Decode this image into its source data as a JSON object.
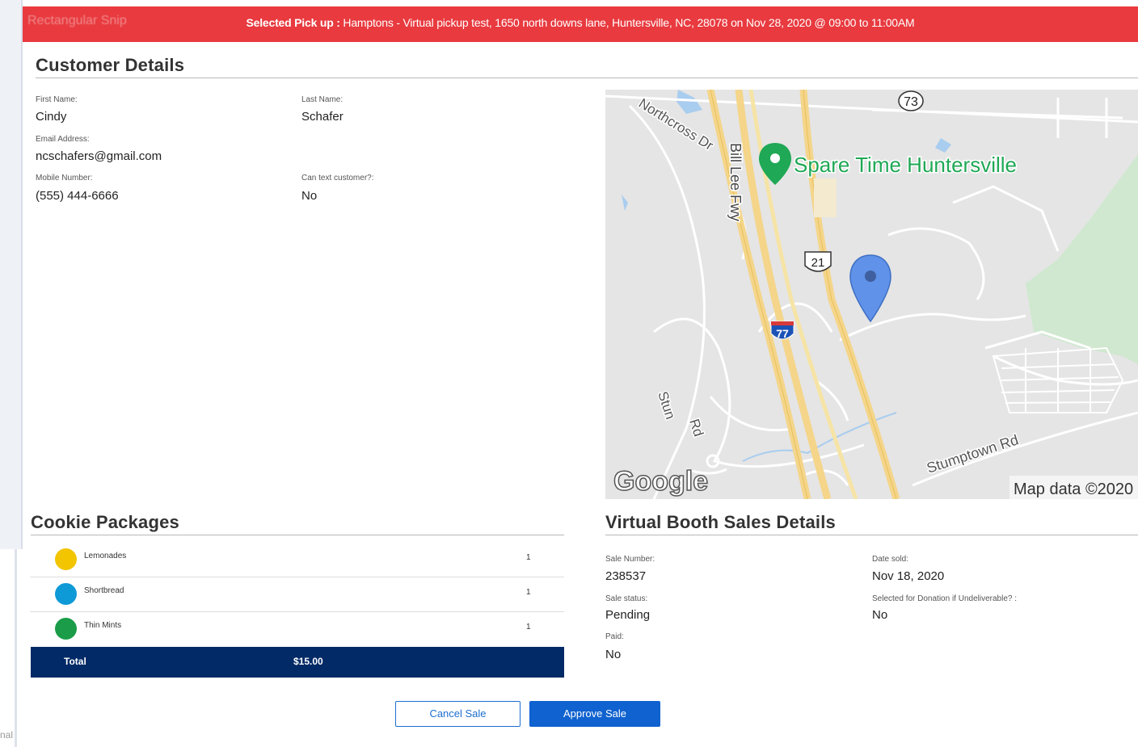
{
  "snip_label": "Rectangular Snip",
  "corner_text": "nal",
  "banner": {
    "prefix": "Selected Pick up :",
    "text": "Hamptons - Virtual pickup test, 1650 north downs lane, Huntersville, NC, 28078 on Nov 28, 2020 @ 09:00 to 11:00AM"
  },
  "customer": {
    "title": "Customer Details",
    "first_name_label": "First Name:",
    "first_name": "Cindy",
    "last_name_label": "Last Name:",
    "last_name": "Schafer",
    "email_label": "Email Address:",
    "email": "ncschafers@gmail.com",
    "mobile_label": "Mobile Number:",
    "mobile": "(555) 444-6666",
    "can_text_label": "Can text customer?:",
    "can_text": "No"
  },
  "map": {
    "place_label": "Spare Time Huntersville",
    "road_northcross": "Northcross Dr",
    "road_billlee": "Bill Lee Fwy",
    "road_stumptown": "Stumptown Rd",
    "road_stun": "Stun",
    "road_rd": "Rd",
    "shield_73": "73",
    "shield_21": "21",
    "shield_77": "77",
    "google_logo": "Google",
    "attribution": "Map data ©2020"
  },
  "packages": {
    "title": "Cookie Packages",
    "items": [
      {
        "name": "Lemonades",
        "qty": "1",
        "color": "#f2c500"
      },
      {
        "name": "Shortbread",
        "qty": "1",
        "color": "#0e9ad7"
      },
      {
        "name": "Thin Mints",
        "qty": "1",
        "color": "#1a9c48"
      }
    ],
    "total_label": "Total",
    "total_value": "$15.00"
  },
  "sale": {
    "title": "Virtual Booth Sales Details",
    "number_label": "Sale Number:",
    "number": "238537",
    "date_label": "Date sold:",
    "date": "Nov 18, 2020",
    "status_label": "Sale status:",
    "status": "Pending",
    "donation_label": "Selected for Donation if Undeliverable? :",
    "donation": "No",
    "paid_label": "Paid:",
    "paid": "No"
  },
  "actions": {
    "cancel": "Cancel Sale",
    "approve": "Approve Sale"
  },
  "colors": {
    "banner": "#e83a3f",
    "total_bar": "#012a66",
    "primary": "#0f62cf"
  }
}
